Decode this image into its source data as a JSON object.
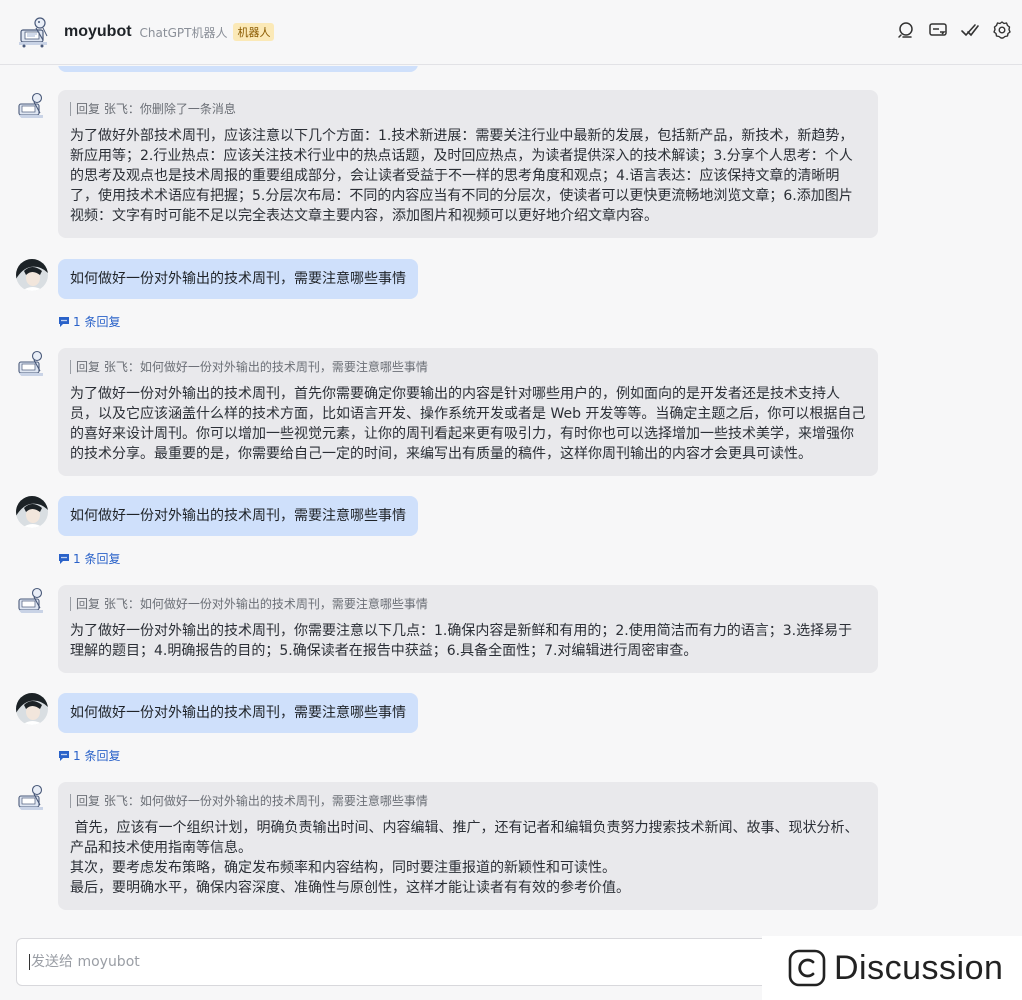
{
  "header": {
    "name": "moyubot",
    "subtitle": "ChatGPT机器人",
    "badge": "机器人",
    "icons": [
      "search-icon",
      "card-icon",
      "double-check-icon",
      "gear-icon"
    ]
  },
  "messages": [
    {
      "type": "bot",
      "reply_to": "回复 张飞：你删除了一条消息",
      "text": "为了做好外部技术周刊，应该注意以下几个方面：1.技术新进展：需要关注行业中最新的发展，包括新产品，新技术，新趋势，新应用等；2.行业热点：应该关注技术行业中的热点话题，及时回应热点，为读者提供深入的技术解读；3.分享个人思考：个人的思考及观点也是技术周报的重要组成部分，会让读者受益于不一样的思考角度和观点；4.语言表达：应该保持文章的清晰明了，使用技术术语应有把握；5.分层次布局：不同的内容应当有不同的分层次，使读者可以更快更流畅地浏览文章；6.添加图片视频：文字有时可能不足以完全表达文章主要内容，添加图片和视频可以更好地介绍文章内容。"
    },
    {
      "type": "user",
      "text": "如何做好一份对外输出的技术周刊，需要注意哪些事情",
      "reply_count": "1 条回复"
    },
    {
      "type": "bot",
      "reply_to": "回复 张飞：如何做好一份对外输出的技术周刊，需要注意哪些事情",
      "text": "为了做好一份对外输出的技术周刊，首先你需要确定你要输出的内容是针对哪些用户的，例如面向的是开发者还是技术支持人员，以及它应该涵盖什么样的技术方面，比如语言开发、操作系统开发或者是 Web 开发等等。当确定主题之后，你可以根据自己的喜好来设计周刊。你可以增加一些视觉元素，让你的周刊看起来更有吸引力，有时你也可以选择增加一些技术美学，来增强你的技术分享。最重要的是，你需要给自己一定的时间，来编写出有质量的稿件，这样你周刊输出的内容才会更具可读性。"
    },
    {
      "type": "user",
      "text": "如何做好一份对外输出的技术周刊，需要注意哪些事情",
      "reply_count": "1 条回复"
    },
    {
      "type": "bot",
      "reply_to": "回复 张飞：如何做好一份对外输出的技术周刊，需要注意哪些事情",
      "text": "为了做好一份对外输出的技术周刊，你需要注意以下几点：1.确保内容是新鲜和有用的；2.使用简洁而有力的语言；3.选择易于理解的题目；4.明确报告的目的；5.确保读者在报告中获益；6.具备全面性；7.对编辑进行周密审查。"
    },
    {
      "type": "user",
      "text": "如何做好一份对外输出的技术周刊，需要注意哪些事情",
      "reply_count": "1 条回复"
    },
    {
      "type": "bot",
      "reply_to": "回复 张飞：如何做好一份对外输出的技术周刊，需要注意哪些事情",
      "text": " 首先，应该有一个组织计划，明确负责输出时间、内容编辑、推广，还有记者和编辑负责努力搜索技术新闻、故事、现状分析、产品和技术使用指南等信息。\n其次，要考虑发布策略，确定发布频率和内容结构，同时要注重报道的新颖性和可读性。\n最后，要明确水平，确保内容深度、准确性与原创性，这样才能让读者有有效的参考价值。"
    }
  ],
  "composer": {
    "placeholder": "发送给 moyubot"
  },
  "watermark": {
    "text": "Discussion"
  }
}
